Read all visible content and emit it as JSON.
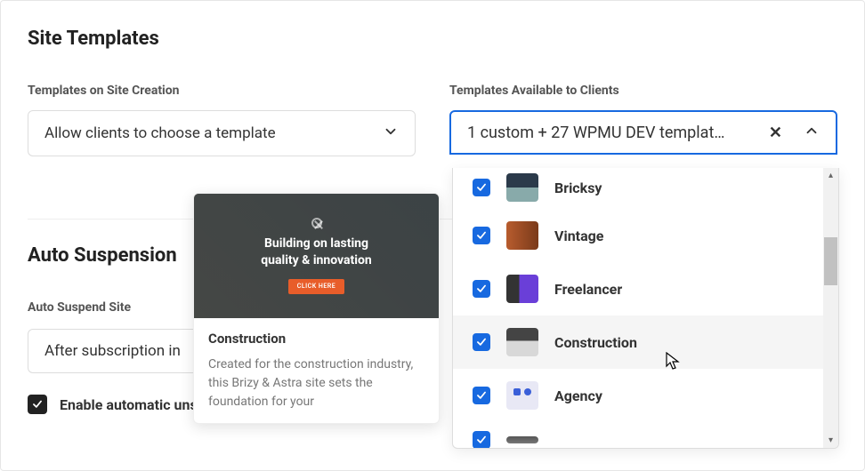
{
  "page": {
    "title": "Site Templates"
  },
  "templates_on_creation": {
    "label": "Templates on Site Creation",
    "value": "Allow clients to choose a template"
  },
  "templates_available": {
    "label": "Templates Available to Clients",
    "summary": "1 custom + 27 WPMU DEV templat…",
    "options": [
      {
        "label": "Bricksy",
        "checked": true,
        "thumb_class": "th-bricksy"
      },
      {
        "label": "Vintage",
        "checked": true,
        "thumb_class": "th-vintage"
      },
      {
        "label": "Freelancer",
        "checked": true,
        "thumb_class": "th-freelancer"
      },
      {
        "label": "Construction",
        "checked": true,
        "thumb_class": "th-construction",
        "hover": true
      },
      {
        "label": "Agency",
        "checked": true,
        "thumb_class": "th-agency"
      },
      {
        "label": "",
        "checked": true,
        "thumb_class": "th-partial",
        "partial": true
      }
    ]
  },
  "tooltip": {
    "hero_line1": "Building on lasting",
    "hero_line2": "quality & innovation",
    "hero_button": "CLICK HERE",
    "title": "Construction",
    "desc": "Created for the construction industry, this Brizy & Astra site sets the foundation for your"
  },
  "auto_suspension": {
    "title": "Auto Suspension",
    "sub_label": "Auto Suspend Site",
    "value": "After subscription in",
    "unsuspend_label": "Enable automatic unsuspension when the pending in",
    "unsuspend_checked": true
  }
}
